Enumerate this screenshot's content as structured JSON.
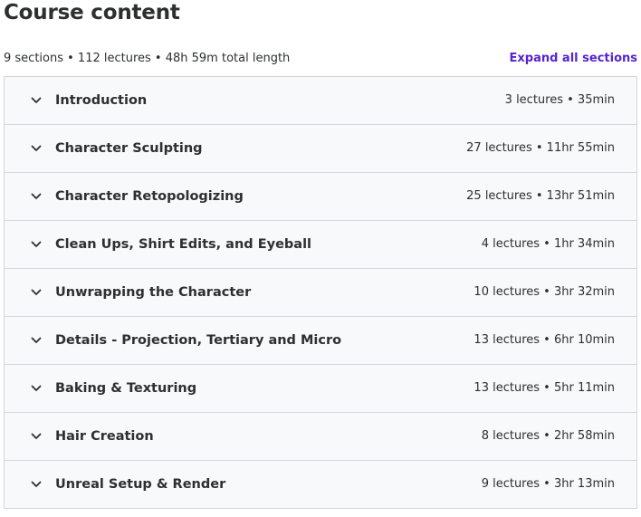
{
  "header": {
    "title": "Course content",
    "summary": "9 sections • 112 lectures • 48h 59m total length",
    "expand_label": "Expand all sections"
  },
  "sections": [
    {
      "title": "Introduction",
      "meta": "3 lectures • 35min"
    },
    {
      "title": "Character Sculpting",
      "meta": "27 lectures • 11hr 55min"
    },
    {
      "title": "Character Retopologizing",
      "meta": "25 lectures • 13hr 51min"
    },
    {
      "title": "Clean Ups, Shirt Edits, and Eyeball",
      "meta": "4 lectures • 1hr 34min"
    },
    {
      "title": "Unwrapping the Character",
      "meta": "10 lectures • 3hr 32min"
    },
    {
      "title": "Details - Projection, Tertiary and Micro",
      "meta": "13 lectures • 6hr 10min"
    },
    {
      "title": "Baking & Texturing",
      "meta": "13 lectures • 5hr 11min"
    },
    {
      "title": "Hair Creation",
      "meta": "8 lectures • 2hr 58min"
    },
    {
      "title": "Unreal Setup & Render",
      "meta": "9 lectures • 3hr 13min"
    }
  ],
  "icons": {
    "section_toggle": "chevron-down-icon"
  },
  "colors": {
    "accent": "#5624d0",
    "row_background": "#f7f9fa",
    "border": "#d1d7dc",
    "text": "#2d2f31"
  }
}
